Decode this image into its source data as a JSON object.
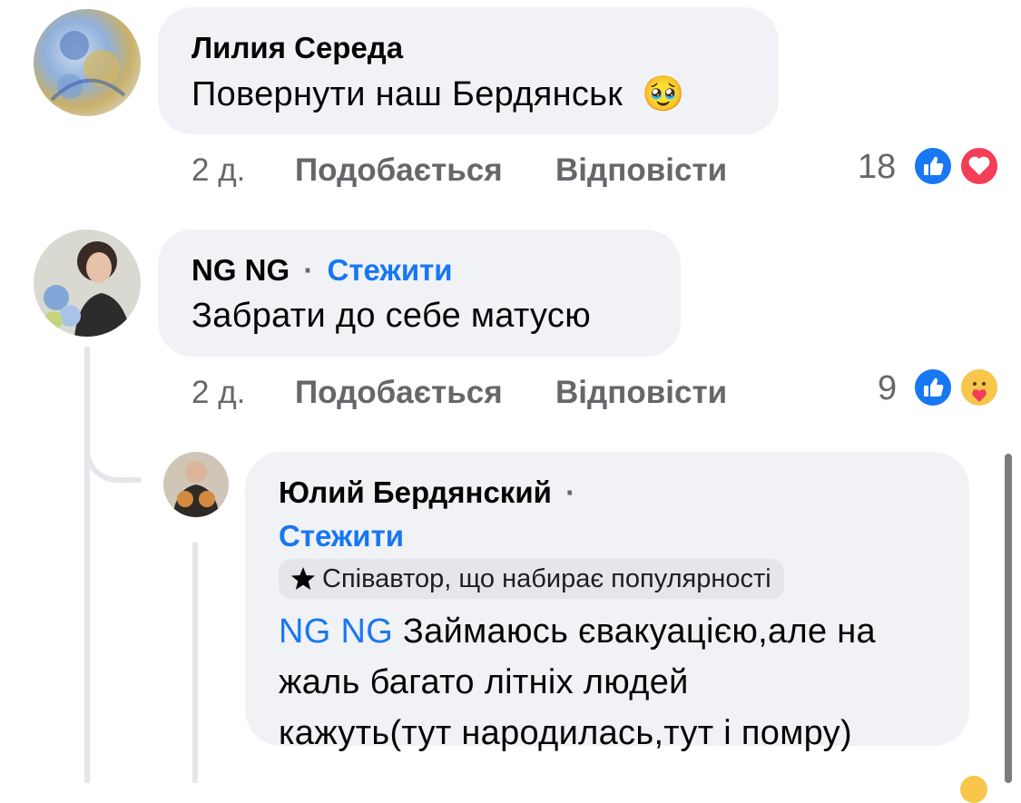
{
  "comments": [
    {
      "author": "Лилия Середа",
      "text": "Повернути наш Бердянськ",
      "emoji": "🥹",
      "time": "2 д.",
      "like_label": "Подобається",
      "reply_label": "Відповісти",
      "reaction_count": "18",
      "reactions": [
        "like-icon",
        "love-icon"
      ]
    },
    {
      "author": "NG NG",
      "separator": "·",
      "follow_label": "Стежити",
      "text": "Забрати до себе матусю",
      "time": "2 д.",
      "like_label": "Подобається",
      "reply_label": "Відповісти",
      "reaction_count": "9",
      "reactions": [
        "like-icon",
        "care-icon"
      ]
    }
  ],
  "reply": {
    "author": "Юлий Бердянский",
    "separator": "·",
    "follow_label": "Стежити",
    "badge": "Співавтор, що набирає популярності",
    "mention": "NG NG",
    "text_line1": " Займаюсь євакуацією,але на",
    "text_line2": "жаль багато літніх людей",
    "text_line3": "кажуть(тут народилась,тут і помру)"
  },
  "colors": {
    "accent": "#1877f2",
    "bubble": "#f0f2f5",
    "muted": "#65676b",
    "love": "#f33e58"
  }
}
